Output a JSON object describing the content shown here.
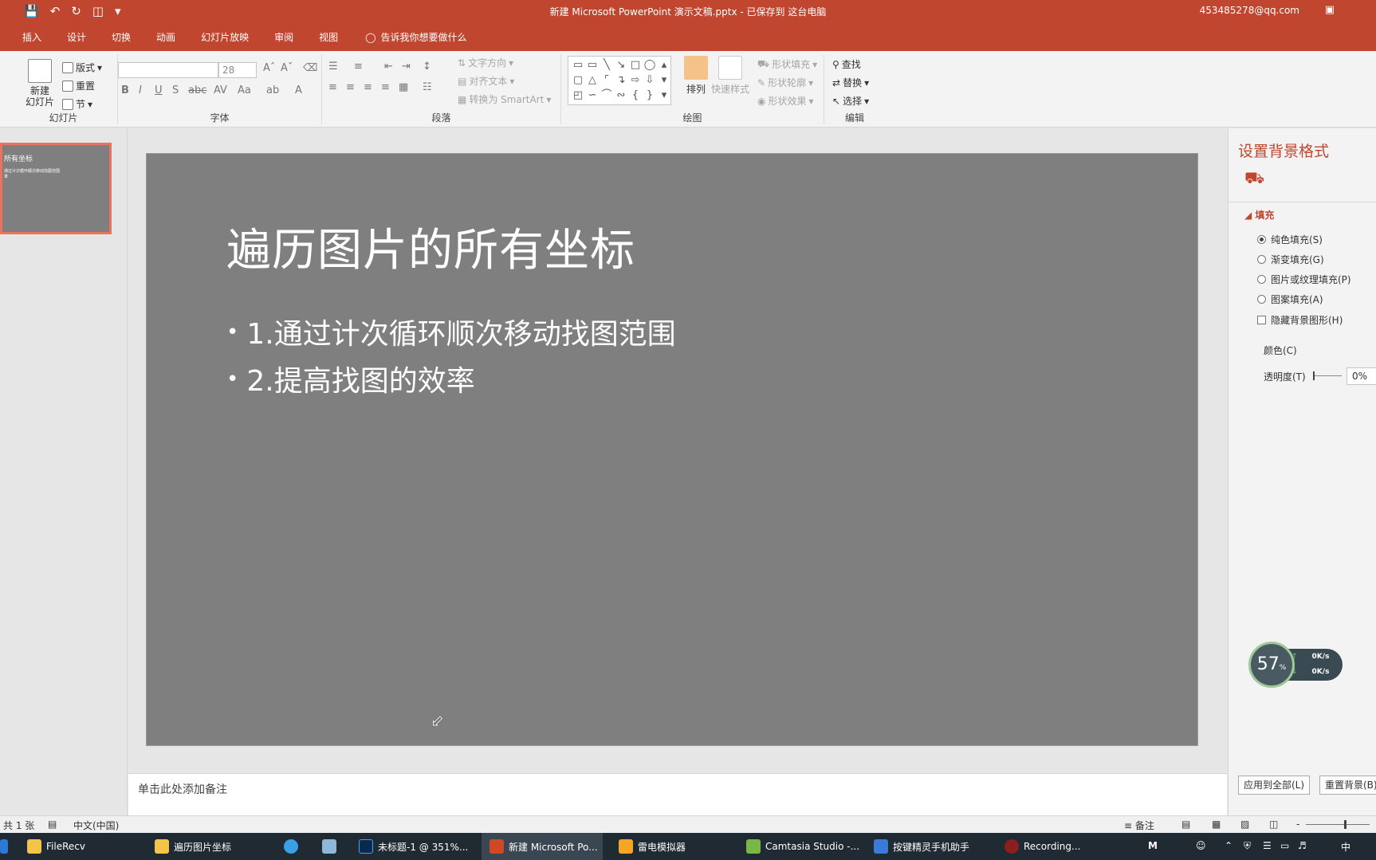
{
  "window": {
    "title": "新建 Microsoft PowerPoint 演示文稿.pptx - 已保存到 这台电脑",
    "account": "453485278@qq.com"
  },
  "tabs": [
    {
      "label": "插入"
    },
    {
      "label": "设计"
    },
    {
      "label": "切换"
    },
    {
      "label": "动画"
    },
    {
      "label": "幻灯片放映"
    },
    {
      "label": "审阅"
    },
    {
      "label": "视图"
    }
  ],
  "tellme": "告诉我你想要做什么",
  "ribbon": {
    "slides": {
      "new_slide": "新建\n幻灯片",
      "layout": "版式",
      "reset": "重置",
      "section": "节",
      "label": "幻灯片"
    },
    "font": {
      "font_name": "",
      "font_size": "28",
      "label": "字体"
    },
    "paragraph": {
      "text_direction": "文字方向",
      "align_text": "对齐文本",
      "convert_smartart": "转换为 SmartArt",
      "label": "段落"
    },
    "drawing": {
      "arrange": "排列",
      "quick_styles": "快速样式",
      "shape_fill": "形状填充",
      "shape_outline": "形状轮廓",
      "shape_effects": "形状效果",
      "label": "绘图"
    },
    "editing": {
      "find": "查找",
      "replace": "替换",
      "select": "选择",
      "label": "编辑"
    }
  },
  "thumbnail": {
    "title": "所有坐标",
    "body": "通过计次循环顺次移动找图范围\n率"
  },
  "slide": {
    "title": "遍历图片的所有坐标",
    "bullets": [
      "1.通过计次循环顺次移动找图范围",
      "2.提高找图的效率"
    ]
  },
  "notes_placeholder": "单击此处添加备注",
  "format_pane": {
    "title": "设置背景格式",
    "fill_section": "填充",
    "options": [
      {
        "label": "纯色填充(S)",
        "checked": true
      },
      {
        "label": "渐变填充(G)",
        "checked": false
      },
      {
        "label": "图片或纹理填充(P)",
        "checked": false
      },
      {
        "label": "图案填充(A)",
        "checked": false
      }
    ],
    "hide_background": "隐藏背景图形(H)",
    "color_label": "颜色(C)",
    "transparency_label": "透明度(T)",
    "transparency_value": "0%",
    "apply_all": "应用到全部(L)",
    "reset_background": "重置背景(B)"
  },
  "net_widget": {
    "percent": "57",
    "percent_unit": "%",
    "up": "0K/s",
    "down": "0K/s"
  },
  "statusbar": {
    "slide_count": "共 1 张",
    "language": "中文(中国)",
    "notes": "备注"
  },
  "taskbar": {
    "items": [
      {
        "label": "FileRecv"
      },
      {
        "label": "遍历图片坐标"
      },
      {
        "label": "未标题-1 @ 351%..."
      },
      {
        "label": "新建 Microsoft Po..."
      },
      {
        "label": "雷电模拟器"
      },
      {
        "label": "Camtasia Studio -..."
      },
      {
        "label": "按键精灵手机助手"
      },
      {
        "label": "Recording..."
      }
    ],
    "ime": "中"
  },
  "colors": {
    "accent": "#c1462f",
    "slide_bg": "#7f7f7f",
    "thumb_border": "#e8735e",
    "taskbar": "#1f2a33"
  }
}
